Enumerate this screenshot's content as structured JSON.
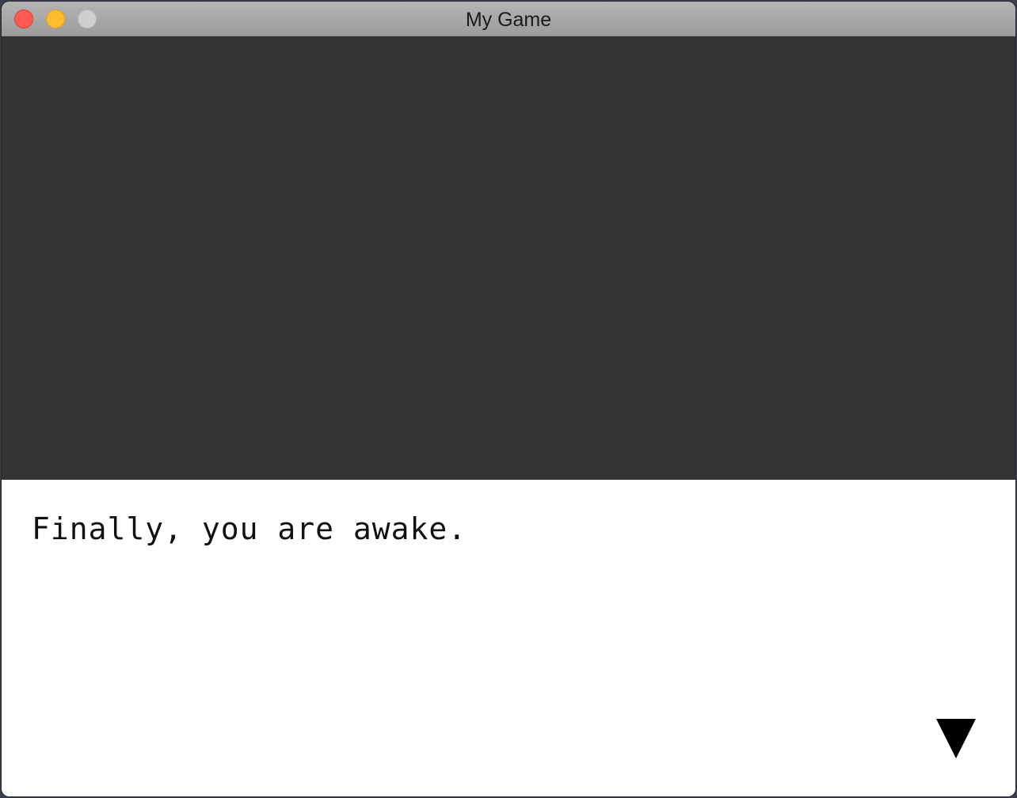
{
  "window": {
    "title": "My Game"
  },
  "dialog": {
    "text": "Finally, you are awake.",
    "advance_icon": "triangle-down-icon"
  },
  "colors": {
    "scene_background": "#333333",
    "dialog_background": "#ffffff",
    "text": "#111111"
  }
}
